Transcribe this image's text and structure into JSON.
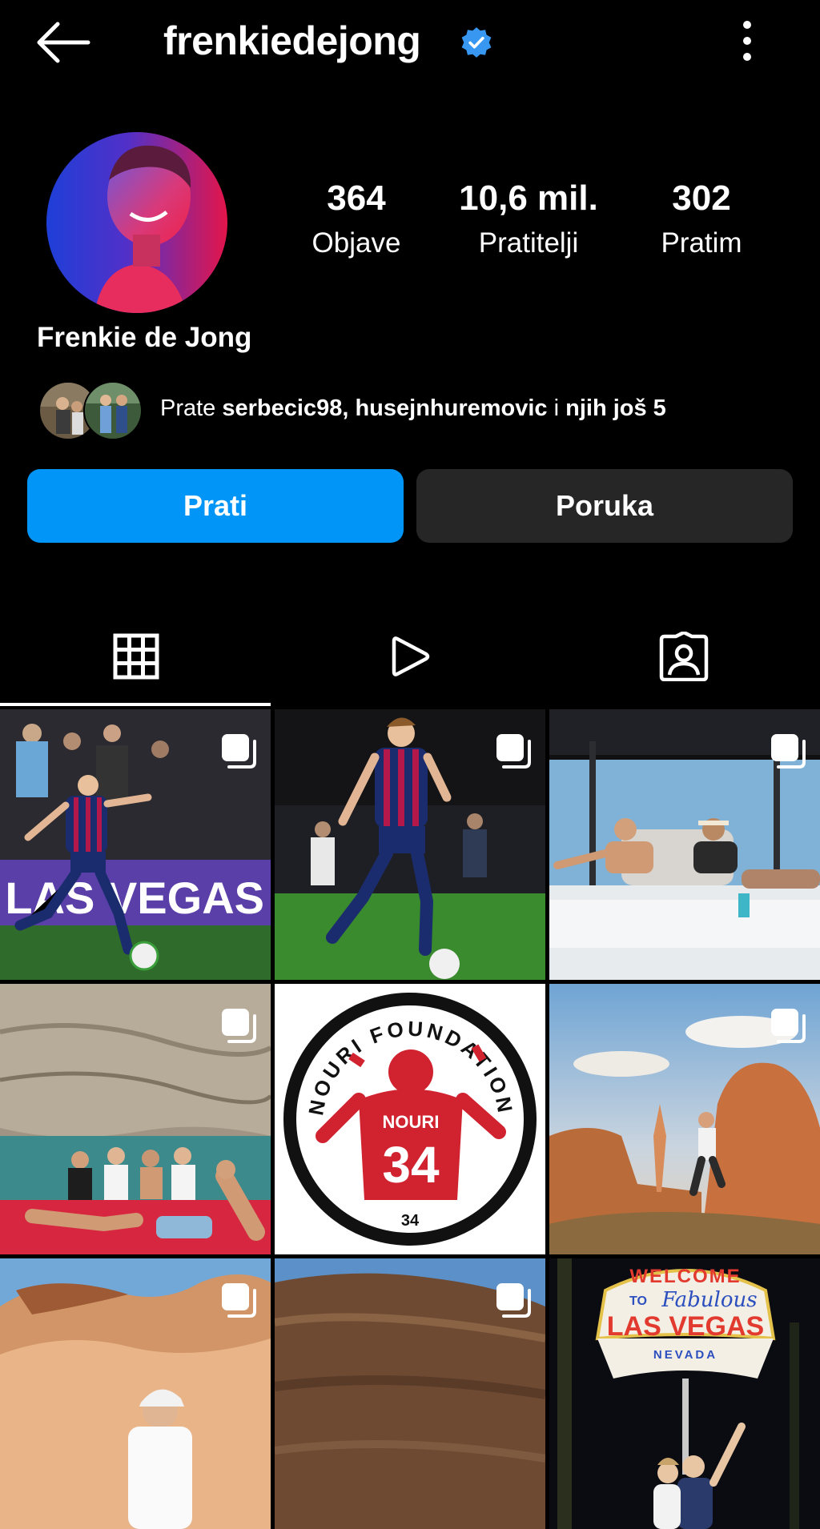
{
  "header": {
    "username": "frenkiedejong"
  },
  "profile": {
    "display_name": "Frenkie de Jong",
    "stats": [
      {
        "value": "364",
        "label": "Objave"
      },
      {
        "value": "10,6 mil.",
        "label": "Pratitelji"
      },
      {
        "value": "302",
        "label": "Pratim"
      }
    ],
    "mutual": {
      "prefix": "Prate ",
      "names": "serbecic98, husejnhuremovic",
      "suffix_plain": " i ",
      "suffix_bold": "njih još 5"
    }
  },
  "buttons": {
    "follow": "Prati",
    "message": "Poruka"
  },
  "tabs": [
    {
      "icon": "grid-icon",
      "active": true
    },
    {
      "icon": "reels-icon",
      "active": false
    },
    {
      "icon": "tagged-icon",
      "active": false
    }
  ],
  "posts": [
    {
      "scene": "footballer-las-vegas",
      "multi": true
    },
    {
      "scene": "footballer-stadium",
      "multi": true
    },
    {
      "scene": "boat-deck",
      "multi": true
    },
    {
      "scene": "friends-on-boat",
      "multi": true
    },
    {
      "scene": "nouri-foundation-logo",
      "multi": false
    },
    {
      "scene": "desert-proposal",
      "multi": true
    },
    {
      "scene": "canyon-rocks",
      "multi": true
    },
    {
      "scene": "canyon-wall",
      "multi": true
    },
    {
      "scene": "las-vegas-sign",
      "multi": false
    }
  ],
  "logo_text": {
    "foundation": "NOURI FOUNDATION",
    "shirt_name": "NOURI",
    "shirt_number": "34",
    "badge_number": "34"
  },
  "sign_text": {
    "welcome": "WELCOME",
    "to": "TO",
    "fabulous": "Fabulous",
    "city": "LAS VEGAS",
    "state": "NEVADA"
  },
  "billboard_text": "LAS VEGAS",
  "colors": {
    "accent": "#0095f6",
    "verified": "#3897f0",
    "secondary_button": "#262626"
  }
}
